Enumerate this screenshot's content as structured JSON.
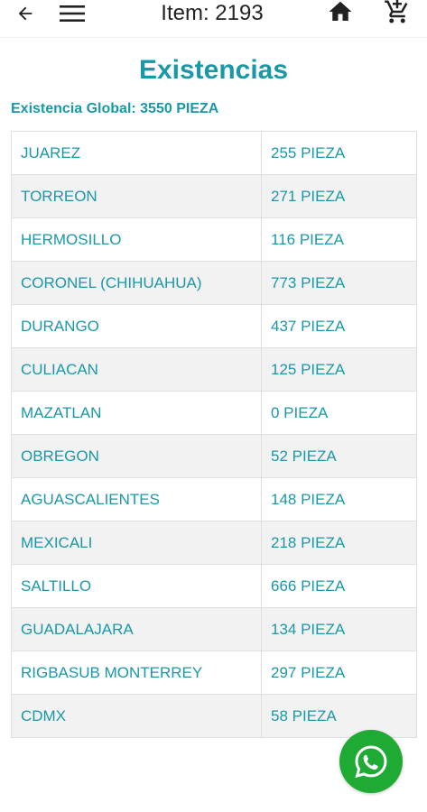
{
  "header": {
    "title": "Item: 2193",
    "icons": [
      "back-arrow-icon",
      "menu-icon",
      "home-icon",
      "add-to-cart-icon"
    ]
  },
  "page": {
    "heading": "Existencias",
    "global_stock": "Existencia Global: 3550 PIEZA"
  },
  "stock_rows": [
    {
      "location": "JUAREZ",
      "quantity": "255 PIEZA"
    },
    {
      "location": "TORREON",
      "quantity": "271 PIEZA"
    },
    {
      "location": "HERMOSILLO",
      "quantity": "116 PIEZA"
    },
    {
      "location": "CORONEL (CHIHUAHUA)",
      "quantity": "773 PIEZA"
    },
    {
      "location": "DURANGO",
      "quantity": "437 PIEZA"
    },
    {
      "location": "CULIACAN",
      "quantity": "125 PIEZA"
    },
    {
      "location": "MAZATLAN",
      "quantity": "0 PIEZA"
    },
    {
      "location": "OBREGON",
      "quantity": "52 PIEZA"
    },
    {
      "location": "AGUASCALIENTES",
      "quantity": "148 PIEZA"
    },
    {
      "location": "MEXICALI",
      "quantity": "218 PIEZA"
    },
    {
      "location": "SALTILLO",
      "quantity": "666 PIEZA"
    },
    {
      "location": "GUADALAJARA",
      "quantity": "134 PIEZA"
    },
    {
      "location": "RIGBASUB MONTERREY",
      "quantity": "297 PIEZA"
    },
    {
      "location": "CDMX",
      "quantity": "58 PIEZA"
    }
  ],
  "fab": {
    "icon": "whatsapp-icon"
  },
  "colors": {
    "accent": "#1a98a8",
    "whatsapp": "#1faa33",
    "row_alt": "#f2f2f2",
    "border": "#dedede"
  }
}
